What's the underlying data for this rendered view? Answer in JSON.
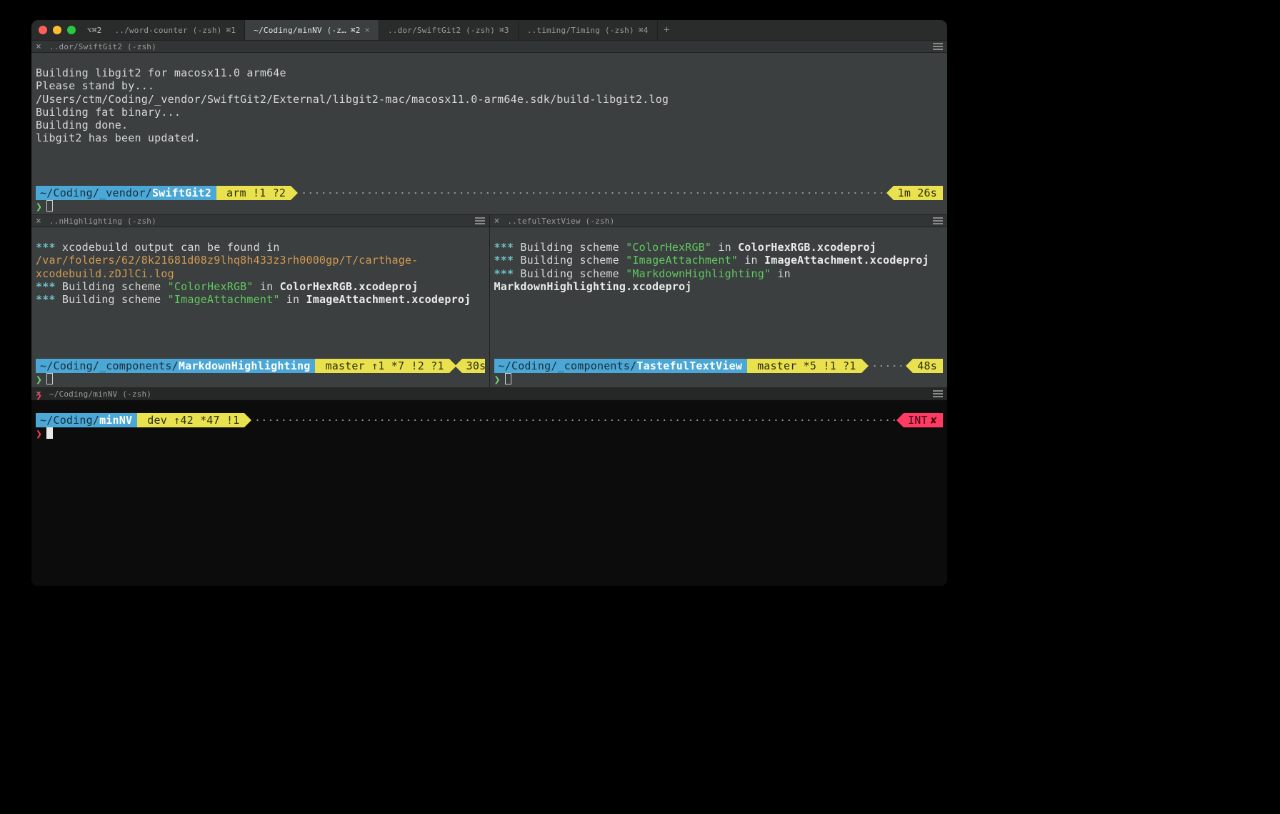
{
  "window": {
    "prefix_icon": "⌥⌘2",
    "tabs": [
      {
        "label": "../word-counter (-zsh)",
        "shortcut": "⌘1",
        "active": false
      },
      {
        "label": "~/Coding/minNV (-z…",
        "shortcut": "⌘2",
        "active": true
      },
      {
        "label": "..dor/SwiftGit2 (-zsh)",
        "shortcut": "⌘3",
        "active": false
      },
      {
        "label": "..timing/Timing (-zsh)",
        "shortcut": "⌘4",
        "active": false
      }
    ],
    "add_tab": "+"
  },
  "pane1": {
    "title": "..dor/SwiftGit2 (-zsh)",
    "lines": [
      "Building libgit2 for macosx11.0 arm64e",
      "Please stand by...",
      "/Users/ctm/Coding/_vendor/SwiftGit2/External/libgit2-mac/macosx11.0-arm64e.sdk/build-libgit2.log",
      "Building fat binary...",
      "Building done.",
      "libgit2 has been updated."
    ],
    "prompt": {
      "path_pre": "~/Coding/_vendor/",
      "path_hl": "SwiftGit2",
      "branch": "arm !1 ?2",
      "timer": "1m 26s"
    }
  },
  "pane2": {
    "title": "..nHighlighting (-zsh)",
    "line1_pre": "***",
    "line1_mid": " xcodebuild output can be found in ",
    "line1_path": "/var/folders/62/8k21681d08z9lhq8h433z3rh0000gp/T/carthage-xcodebuild.zDJlCi.log",
    "line2_pre": "***",
    "line2_mid": " Building scheme ",
    "line2_q": "\"ColorHexRGB\"",
    "line2_in": " in ",
    "line2_proj": "ColorHexRGB.xcodeproj",
    "line3_pre": "***",
    "line3_mid": " Building scheme ",
    "line3_q": "\"ImageAttachment\"",
    "line3_in": " in ",
    "line3_proj": "ImageAttachment.xcodeproj",
    "prompt": {
      "path_pre": "~/Coding/_components/",
      "path_hl": "MarkdownHighlighting",
      "branch": "master ↑1 *7 !2 ?1",
      "timer": "30s"
    }
  },
  "pane3": {
    "title": "..tefulTextView (-zsh)",
    "l1_pre": "***",
    "l1_mid": " Building scheme ",
    "l1_q": "\"ColorHexRGB\"",
    "l1_in": " in ",
    "l1_proj": "ColorHexRGB.xcodeproj",
    "l2_pre": "***",
    "l2_mid": " Building scheme ",
    "l2_q": "\"ImageAttachment\"",
    "l2_in": " in ",
    "l2_proj": "ImageAttachment.xcodeproj",
    "l3_pre": "***",
    "l3_mid": " Building scheme ",
    "l3_q": "\"MarkdownHighlighting\"",
    "l3_in": " in ",
    "l3_proj": "MarkdownHighlighting.xcodeproj",
    "prompt": {
      "path_pre": "~/Coding/_components/",
      "path_hl": "TastefulTextView",
      "branch": "master *5 !1 ?1",
      "timer": "48s"
    }
  },
  "pane4": {
    "title": "~/Coding/minNV (-zsh)",
    "prompt": {
      "path_pre": "~/Coding/",
      "path_hl": "minNV",
      "branch": "dev ↑42 *47 !1",
      "status": "INT",
      "status_x": "✘"
    }
  },
  "glyphs": {
    "caret": "❯",
    "close": "×"
  }
}
